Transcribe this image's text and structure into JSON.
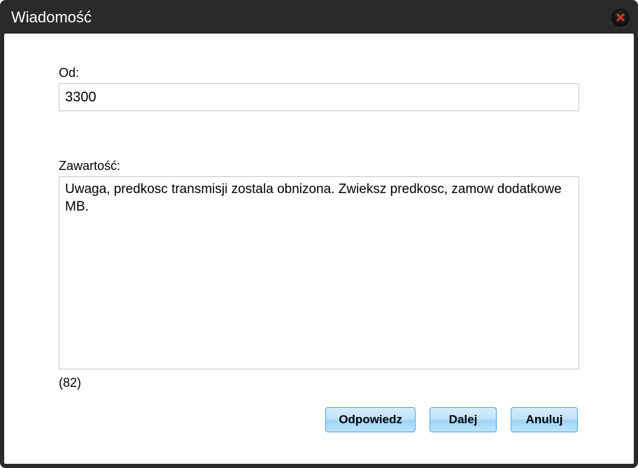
{
  "dialog": {
    "title": "Wiadomość",
    "from_label": "Od:",
    "from_value": "3300",
    "content_label": "Zawartość:",
    "content_value": "Uwaga, predkosc transmisji zostala obnizona. Zwieksz predkosc, zamow dodatkowe MB.",
    "char_count": "(82)",
    "buttons": {
      "reply": "Odpowiedz",
      "next": "Dalej",
      "cancel": "Anuluj"
    }
  }
}
